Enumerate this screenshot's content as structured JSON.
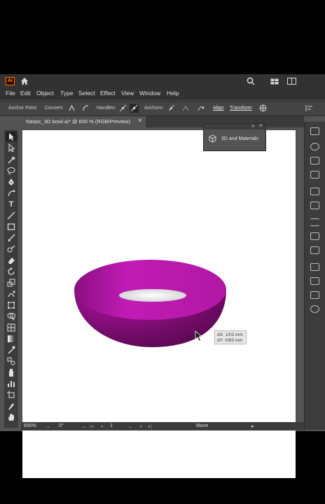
{
  "app": {
    "logo": "Ai",
    "home_icon": "home-icon"
  },
  "menu": [
    "File",
    "Edit",
    "Object",
    "Type",
    "Select",
    "Effect",
    "View",
    "Window",
    "Help"
  ],
  "control_bar": {
    "anchor_point": "Anchor Point",
    "convert": "Convert:",
    "handles": "Handles:",
    "anchors": "Anchors:",
    "align": "Align",
    "transform": "Transform"
  },
  "document": {
    "tab_title": "Narpic_3D bowl.ai* @ 600 % (RGB/Preview)",
    "close": "×"
  },
  "panel": {
    "title": "3D and Materials",
    "collapse": "»",
    "close": "×"
  },
  "tooltip": {
    "dx": "dX: 1/02 mm",
    "dy": "dY: 0/93 mm"
  },
  "status": {
    "zoom": "600%",
    "rotation": "0°",
    "artboard": "1",
    "tool": "Move"
  },
  "colors": {
    "bowl_outer": "#7a0d6f",
    "bowl_inner": "#b51aa8",
    "ui_dark": "#323232"
  }
}
